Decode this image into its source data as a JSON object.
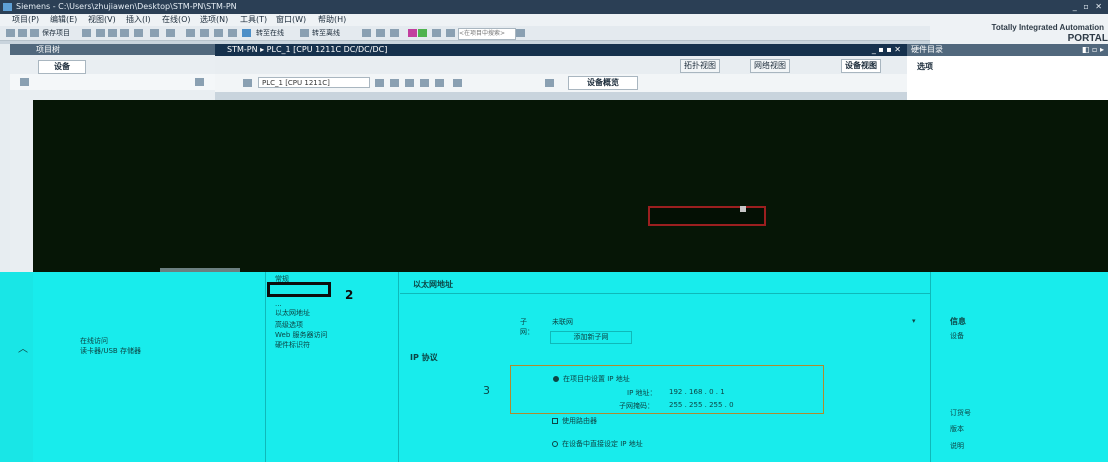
{
  "window": {
    "title": "Siemens - C:\\Users\\zhujiawen\\Desktop\\STM-PN\\STM-PN",
    "controls": "_ ▫ ✕"
  },
  "menu": [
    "项目(P)",
    "编辑(E)",
    "视图(V)",
    "插入(I)",
    "在线(O)",
    "选项(N)",
    "工具(T)",
    "窗口(W)",
    "帮助(H)"
  ],
  "toolbar": {
    "save_project": "保存项目",
    "go_online": "转至在线",
    "go_offline": "转至离线",
    "search_placeholder": "<在项目中搜索>"
  },
  "brand": {
    "line1": "Totally Integrated Automation",
    "line2": "PORTAL"
  },
  "project_tree": {
    "title": "项目树",
    "devices_tab": "设备"
  },
  "editor": {
    "breadcrumb": "STM-PN ▸ PLC_1 [CPU 1211C DC/DC/DC]",
    "controls": "_ ▪ ▪ ✕",
    "views": {
      "topology": "拓扑视图",
      "network": "网络视图",
      "device": "设备视图"
    },
    "device_selector": "PLC_1 [CPU 1211C]",
    "overview": "设备概览"
  },
  "hardware_catalog": {
    "title": "硬件目录",
    "options": "选项"
  },
  "inspector": {
    "tabs": [
      "常规",
      "...",
      "以太网地址",
      "...",
      "高级选项",
      "Web 服务器访问",
      "硬件标识符"
    ],
    "highlight_number": "2",
    "ethernet_title": "以太网地址",
    "subnet_label": "子网：",
    "subnet_value": "未联网",
    "add_subnet": "添加新子网",
    "ip_protocol": "IP 协议",
    "marker_number": "3",
    "set_ip_in_project": "在项目中设置 IP 地址",
    "ip_address_label": "IP 地址：",
    "ip_address": "192 . 168 . 0 . 1",
    "subnet_mask_label": "子网掩码：",
    "subnet_mask": "255 . 255 . 255 . 0",
    "use_router": "使用路由器",
    "set_ip_on_device": "在设备中直接设定 IP 地址"
  },
  "tree_bottom": [
    "在线访问",
    "读卡器/USB 存储器"
  ],
  "info_panel": {
    "title": "信息",
    "items": [
      "设备",
      "订货号",
      "版本",
      "说明"
    ]
  }
}
